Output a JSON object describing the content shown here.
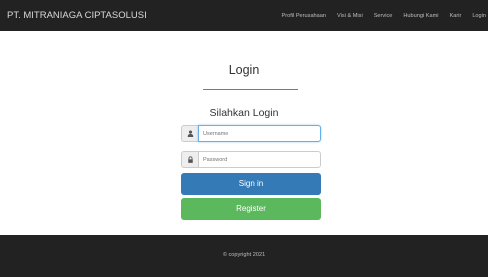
{
  "navbar": {
    "brand": "PT. MITRANIAGA CIPTASOLUSI",
    "items": [
      "Profil Perusahaan",
      "Visi & Misi",
      "Service",
      "Hubungi Kami",
      "Karir",
      "Login"
    ]
  },
  "login": {
    "title": "Login",
    "subtitle": "Silahkan Login",
    "username_placeholder": "Username",
    "password_placeholder": "Password",
    "signin_label": "Sign in",
    "register_label": "Register"
  },
  "footer": {
    "copyright": "© copyright 2021"
  },
  "icons": {
    "username": "user-icon",
    "password": "lock-icon"
  },
  "colors": {
    "navbar_bg": "#222222",
    "primary": "#337ab7",
    "success": "#5cb85c"
  }
}
